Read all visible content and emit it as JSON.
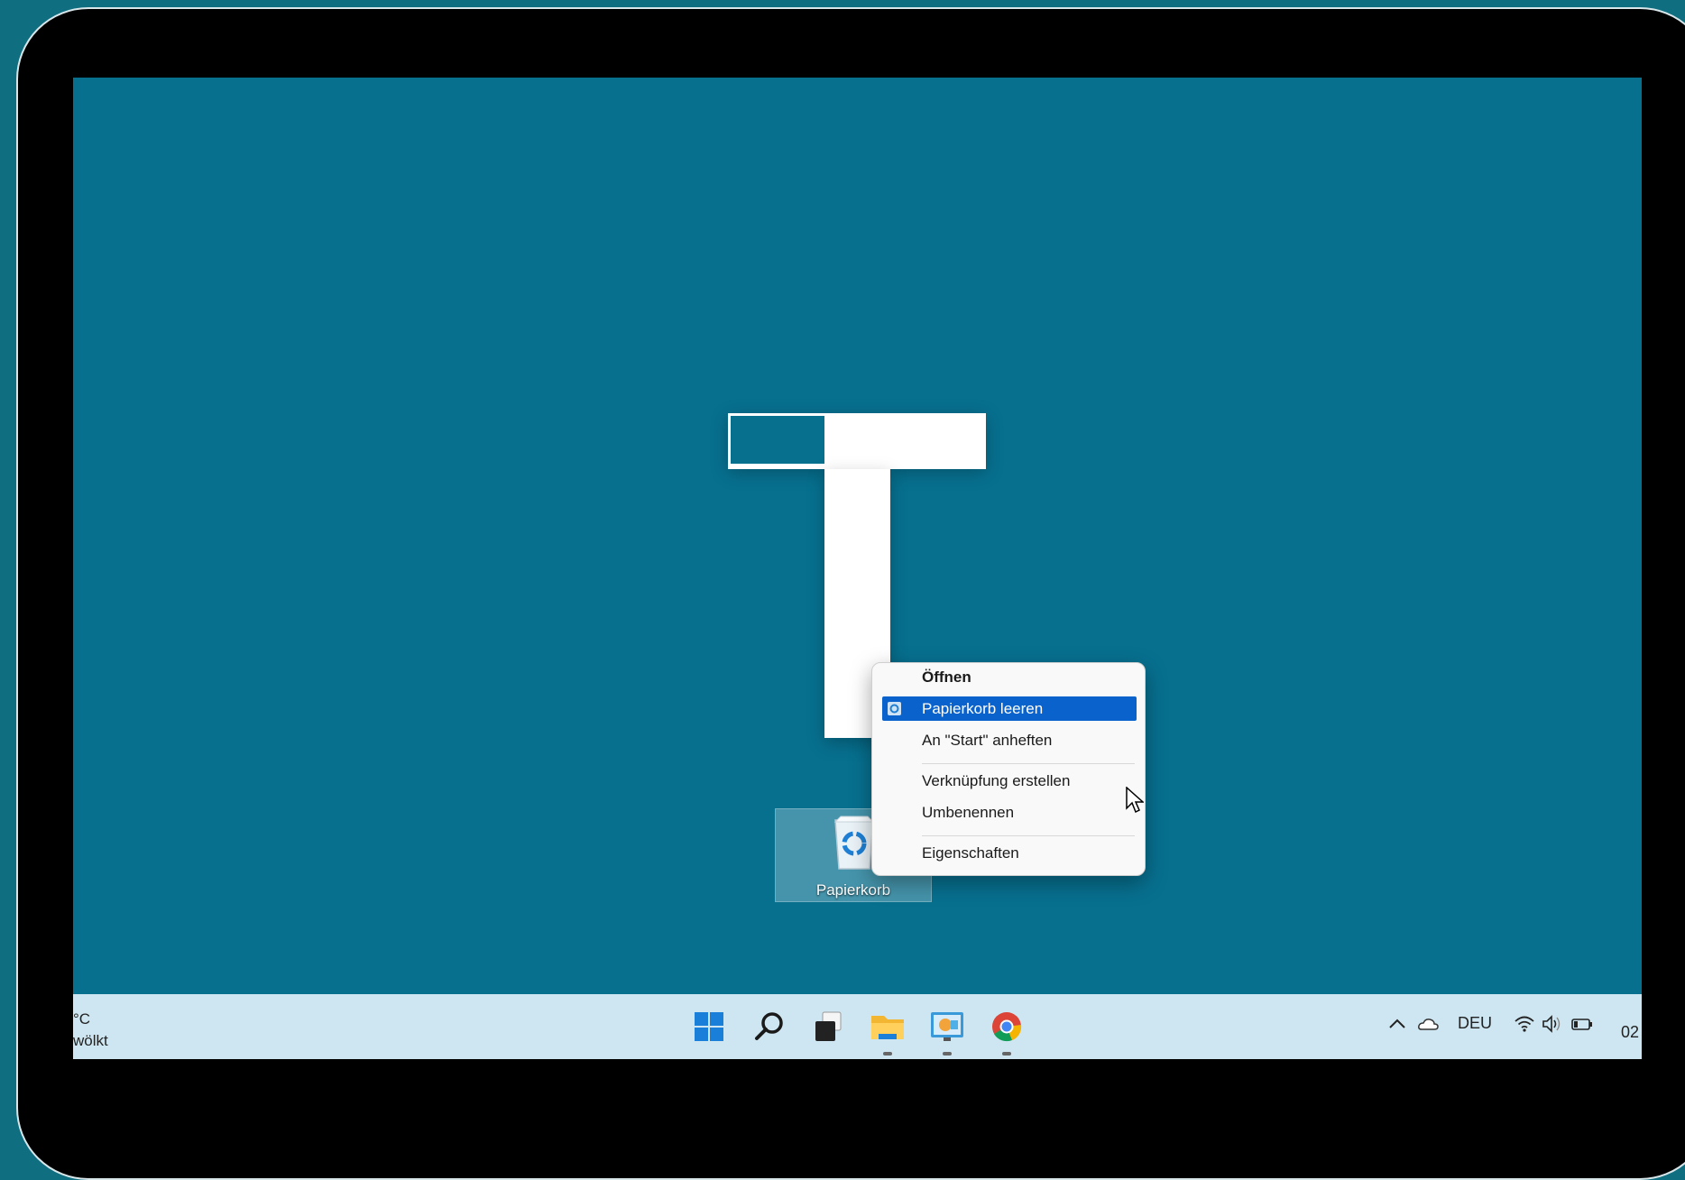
{
  "desktop": {
    "icon_label": "Papierkorb"
  },
  "context_menu": {
    "items": [
      {
        "label": "Öffnen"
      },
      {
        "label": "Papierkorb leeren"
      },
      {
        "label": "An \"Start\" anheften"
      },
      {
        "label": "Verknüpfung erstellen"
      },
      {
        "label": "Umbenennen"
      },
      {
        "label": "Eigenschaften"
      }
    ],
    "highlighted_color": "#0a63cd"
  },
  "taskbar": {
    "weather_line1": "°C",
    "weather_line2": "wölkt",
    "icons": [
      "start-icon",
      "search-icon",
      "task-view-icon",
      "file-explorer-icon",
      "presentation-app-icon",
      "chrome-icon"
    ],
    "language": "DEU",
    "clock": "02"
  },
  "colors": {
    "wallpaper": "#07708f",
    "taskbar": "#cde6f1",
    "accent": "#0a63cd"
  }
}
